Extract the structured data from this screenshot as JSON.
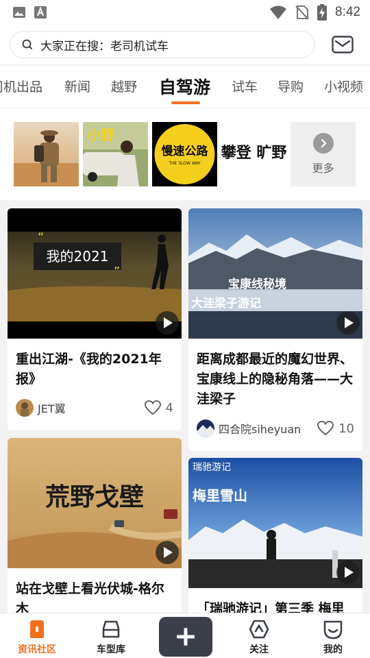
{
  "status_bar": {
    "time": "8:42"
  },
  "search": {
    "text": "大家正在搜：老司机试车"
  },
  "tabs": [
    {
      "label": "司机出品"
    },
    {
      "label": "新闻"
    },
    {
      "label": "越野"
    },
    {
      "label": "自驾游",
      "active": true
    },
    {
      "label": "试车"
    },
    {
      "label": "导购"
    },
    {
      "label": "小视频"
    }
  ],
  "topics": {
    "tiles": [
      {
        "name": "hiker-photo"
      },
      {
        "name": "woman-car-photo",
        "overlay_text": "小野"
      },
      {
        "name": "slow-road-logo",
        "logo_text": "慢速公路",
        "logo_sub": "THE SLOW WAY"
      },
      {
        "name": "calligraphy-logo",
        "logo_text": "攀登 旷野"
      }
    ],
    "more_label": "更多"
  },
  "feed": [
    {
      "title": "重出江湖-《我的2021年报》",
      "overlay_text": "我的2021",
      "author": "JET翼",
      "likes": "4"
    },
    {
      "title": "距离成都最近的魔幻世界、宝康线上的隐秘角落——大洼梁子",
      "overlay_line1": "宝康线秘境",
      "overlay_line2": "大洼梁子游记",
      "author": "四合院siheyuan",
      "likes": "10"
    },
    {
      "title": "站在戈壁上看光伏城-格尔木",
      "overlay_text": "荒野戈壁"
    },
    {
      "title": "「瑞驰游记」第三季 梅里",
      "brand_text": "瑞驰游记",
      "overlay_text": "梅里雪山"
    }
  ],
  "bottom_nav": {
    "items": [
      {
        "label": "资讯社区",
        "active": true
      },
      {
        "label": "车型库"
      },
      {
        "label": "关注"
      },
      {
        "label": "我的"
      }
    ]
  },
  "colors": {
    "accent": "#f2701c",
    "add_button": "#3a3f4a"
  }
}
